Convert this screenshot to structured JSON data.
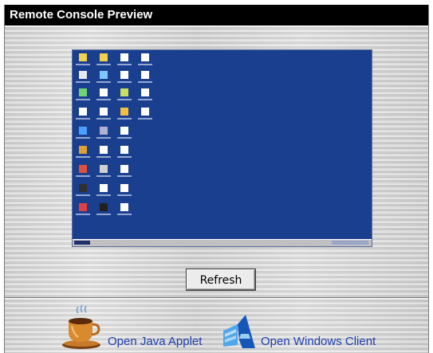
{
  "window": {
    "title": "Remote Console Preview"
  },
  "preview": {
    "desktop_color": "#1b3f8f",
    "refresh_label": "Refresh"
  },
  "links": {
    "java_applet_label": "Open Java Applet",
    "java_icon": "coffee-cup-icon",
    "windows_client_label": "Open Windows Client",
    "windows_icon": "windows-client-icon"
  },
  "colors": {
    "title_bar": "#000000",
    "title_text": "#ffffff",
    "link_text": "#1f3fb0"
  }
}
